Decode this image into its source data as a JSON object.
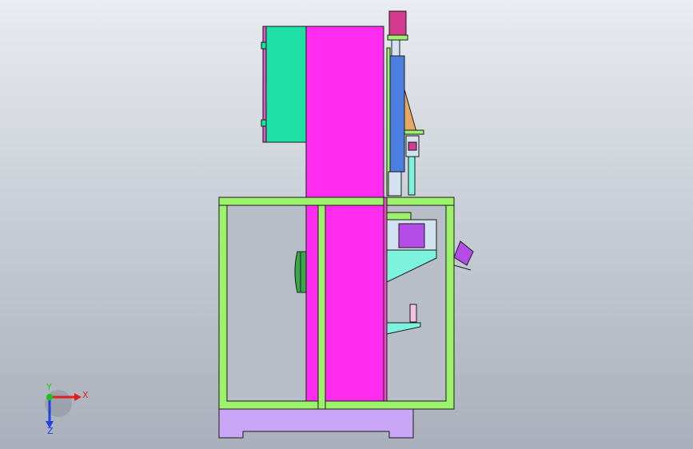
{
  "view": {
    "background_top": "#e9ecf0",
    "background_bottom": "#a9b0bb"
  },
  "machine": {
    "frame_color": "#9cf26a",
    "frame_stroke": "#1a1a1a",
    "column_color": "#ff2cf0",
    "cabinet_color": "#1fe0a4",
    "base_color": "#c9a6f5",
    "slide_color": "#4a7ee0",
    "wedge_color": "#e6a765",
    "cyan_part_color": "#7df2dc",
    "purple_block_color": "#b64ce8",
    "motor_color": "#d3e2f0",
    "handwheel_color": "#3aa84a",
    "cylinder_color": "#d43a8f"
  },
  "triad": {
    "x_label": "X",
    "y_label": "Y",
    "z_label": "Z",
    "x_color": "#e02020",
    "y_color": "#20c020",
    "z_color": "#2040e0",
    "x_icon": "x-axis-arrow-icon",
    "y_icon": "y-axis-dot-icon",
    "z_icon": "z-axis-arrow-icon"
  }
}
